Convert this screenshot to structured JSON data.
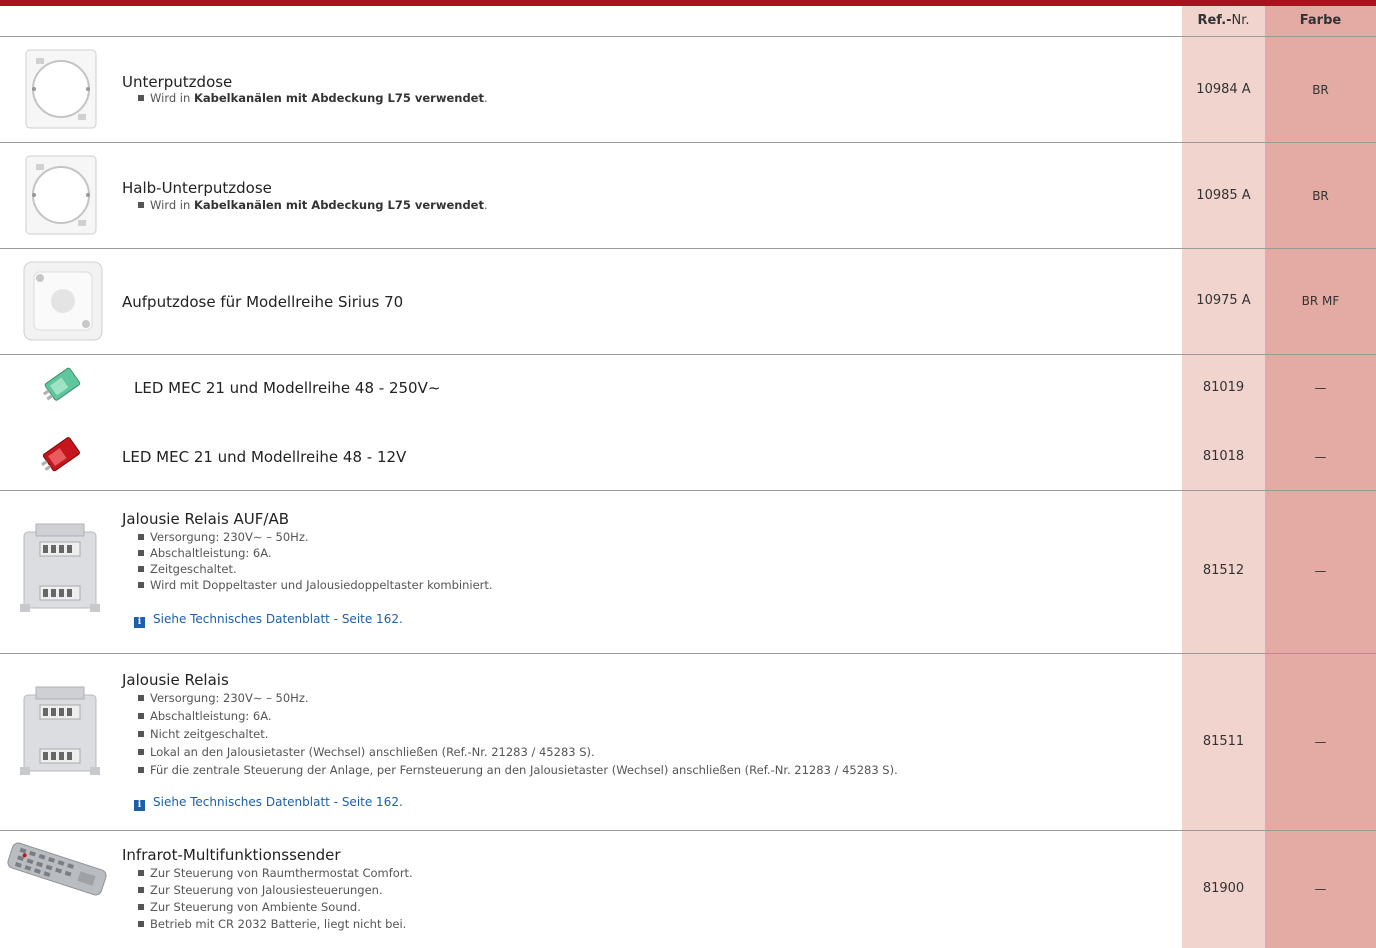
{
  "header": {
    "ref_bold": "Ref.-",
    "ref_rest": "Nr.",
    "farbe": "Farbe"
  },
  "colors": {
    "accent": "#a8121e",
    "ref_col": "#f0d4cd",
    "farbe_col": "#e3aba3",
    "link": "#1d5fa8"
  },
  "info_glyph": "i",
  "products": [
    {
      "title": "Unterputzdose",
      "b1_pre": "Wird in ",
      "b1_bold": "Kabelkanälen mit Abdeckung L75 verwendet",
      "b1_post": ".",
      "ref": "10984 A",
      "farbe": "BR",
      "icon": "flush-box-image"
    },
    {
      "title": "Halb-Unterputzdose",
      "b1_pre": "Wird in ",
      "b1_bold": "Kabelkanälen mit Abdeckung L75 verwendet",
      "b1_post": ".",
      "ref": "10985 A",
      "farbe": "BR",
      "icon": "half-flush-box-image"
    },
    {
      "title": "Aufputzdose für Modellreihe Sirius 70",
      "ref": "10975 A",
      "farbe": "BR MF",
      "icon": "surface-box-image"
    },
    {
      "title": "LED MEC 21 und Modellreihe 48 - 250V∼",
      "ref": "81019",
      "farbe": "—",
      "icon": "green-led-image"
    },
    {
      "title": "LED MEC 21 und Modellreihe 48 - 12V",
      "ref": "81018",
      "farbe": "—",
      "icon": "red-led-image"
    },
    {
      "title": "Jalousie Relais AUF/AB",
      "bullets": [
        "Versorgung: 230V∼ – 50Hz.",
        "Abschaltleistung: 6A.",
        "Zeitgeschaltet.",
        "Wird mit Doppeltaster und Jalousiedoppeltaster kombiniert."
      ],
      "link": "Siehe Technisches Datenblatt - Seite 162.",
      "ref": "81512",
      "farbe": "—",
      "icon": "relay-image"
    },
    {
      "title": "Jalousie Relais",
      "bullets": [
        "Versorgung: 230V∼ – 50Hz.",
        "Abschaltleistung: 6A.",
        "Nicht zeitgeschaltet.",
        "Lokal an den Jalousietaster (Wechsel) anschließen (Ref.-Nr. 21283 / 45283 S).",
        "Für die zentrale Steuerung der Anlage, per Fernsteuerung an den Jalousietaster (Wechsel) anschließen (Ref.-Nr. 21283 / 45283 S)."
      ],
      "link": "Siehe Technisches Datenblatt - Seite 162.",
      "ref": "81511",
      "farbe": "—",
      "icon": "relay-image"
    },
    {
      "title": "Infrarot-Multifunktionssender",
      "bullets": [
        "Zur Steuerung von Raumthermostat Comfort.",
        "Zur Steuerung von Jalousiesteuerungen.",
        "Zur Steuerung von Ambiente Sound.",
        "Betrieb mit CR 2032 Batterie, liegt nicht bei."
      ],
      "ref": "81900",
      "farbe": "—",
      "icon": "remote-control-image"
    }
  ]
}
